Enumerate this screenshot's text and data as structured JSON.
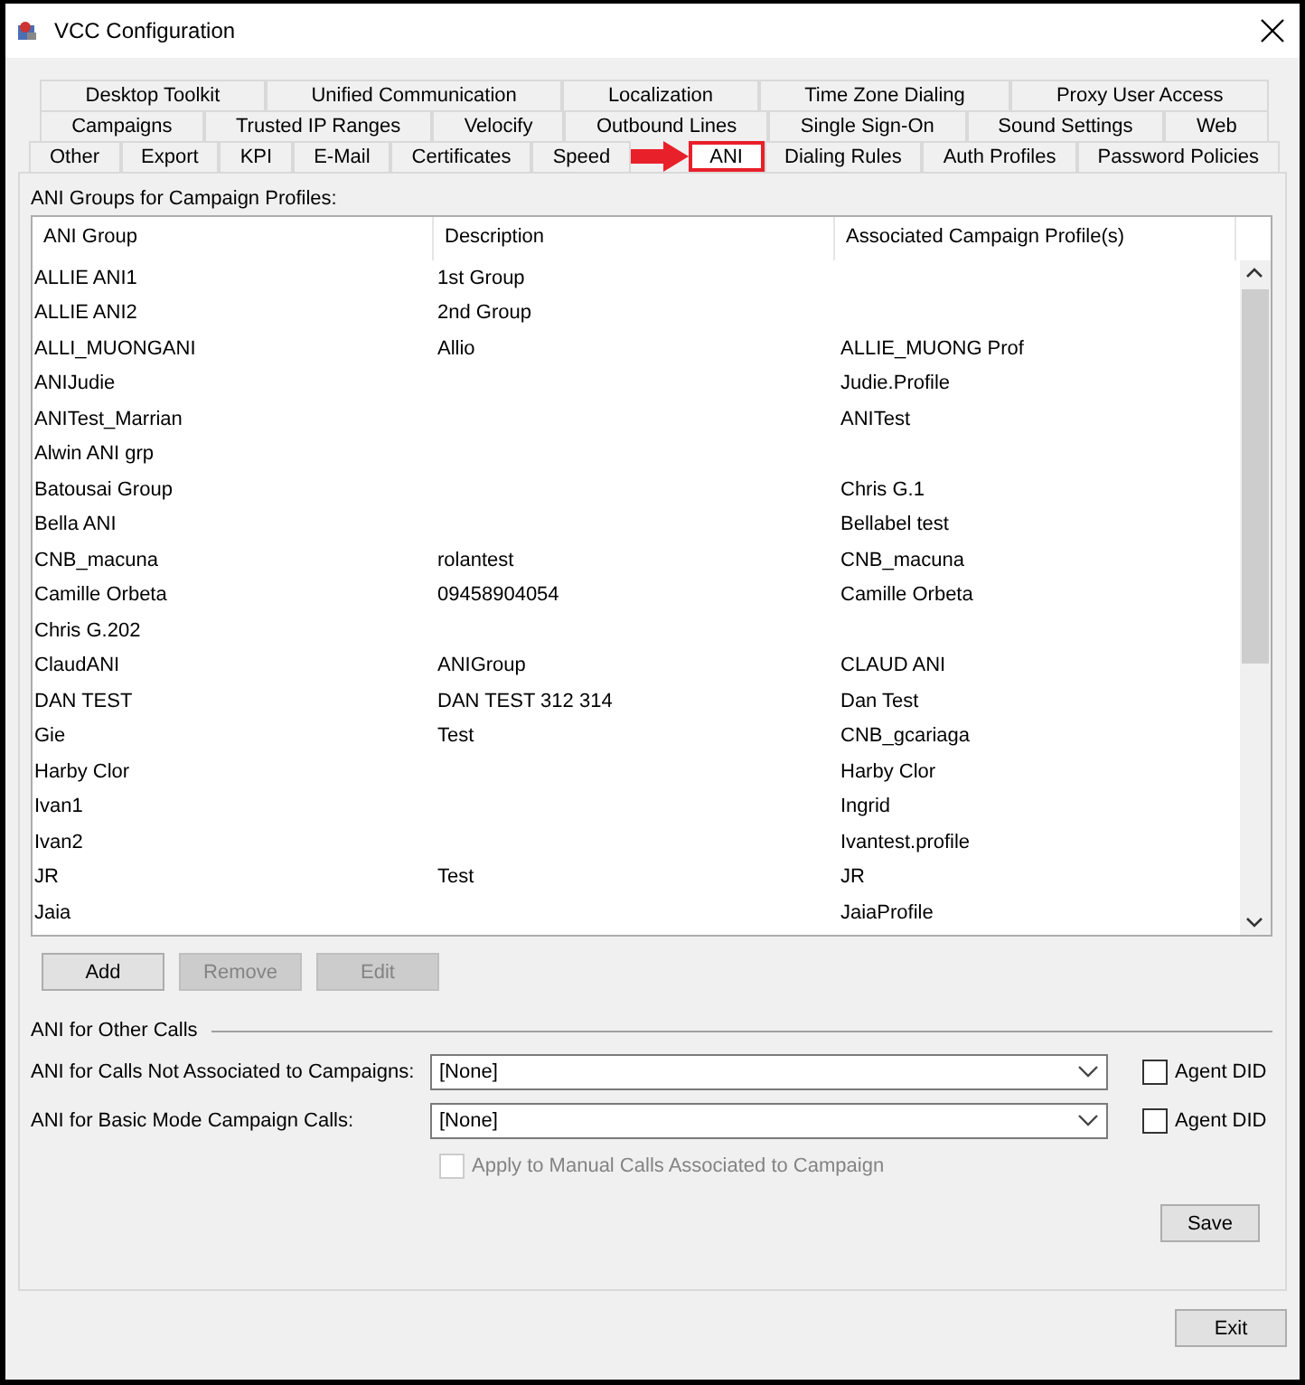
{
  "window": {
    "title": "VCC Configuration"
  },
  "tab_rows": [
    [
      {
        "label": "Desktop Toolkit",
        "selected": false
      },
      {
        "label": "Unified Communication",
        "selected": false
      },
      {
        "label": "Localization",
        "selected": false
      },
      {
        "label": "Time Zone Dialing",
        "selected": false
      },
      {
        "label": "Proxy User Access",
        "selected": false
      }
    ],
    [
      {
        "label": "Campaigns",
        "selected": false
      },
      {
        "label": "Trusted IP Ranges",
        "selected": false
      },
      {
        "label": "Velocify",
        "selected": false
      },
      {
        "label": "Outbound Lines",
        "selected": false
      },
      {
        "label": "Single Sign-On",
        "selected": false
      },
      {
        "label": "Sound Settings",
        "selected": false
      },
      {
        "label": "Web",
        "selected": false
      }
    ],
    [
      {
        "label": "Other",
        "selected": false
      },
      {
        "label": "Export",
        "selected": false
      },
      {
        "label": "KPI",
        "selected": false
      },
      {
        "label": "E-Mail",
        "selected": false
      },
      {
        "label": "Certificates",
        "selected": false
      },
      {
        "label": "Speed",
        "selected": false
      },
      {
        "label": "ANI",
        "selected": true
      },
      {
        "label": "Dialing Rules",
        "selected": false
      },
      {
        "label": "Auth Profiles",
        "selected": false
      },
      {
        "label": "Password Policies",
        "selected": false
      }
    ]
  ],
  "ani_groups": {
    "label": "ANI Groups for Campaign Profiles:",
    "columns": [
      "ANI Group",
      "Description",
      "Associated Campaign Profile(s)"
    ],
    "rows": [
      [
        "ALLIE ANI1",
        "1st Group",
        ""
      ],
      [
        "ALLIE ANI2",
        "2nd Group",
        ""
      ],
      [
        "ALLI_MUONGANI",
        "Allio",
        "ALLIE_MUONG Prof"
      ],
      [
        "ANIJudie",
        "",
        "Judie.Profile"
      ],
      [
        "ANITest_Marrian",
        "",
        "ANITest"
      ],
      [
        "Alwin ANI grp",
        "",
        ""
      ],
      [
        "Batousai Group",
        "",
        "Chris G.1"
      ],
      [
        "Bella ANI",
        "",
        "Bellabel test"
      ],
      [
        "CNB_macuna",
        "rolantest",
        "CNB_macuna"
      ],
      [
        "Camille Orbeta",
        "09458904054",
        "Camille Orbeta"
      ],
      [
        "Chris G.202",
        "",
        ""
      ],
      [
        "ClaudANI",
        "ANIGroup",
        "CLAUD ANI"
      ],
      [
        "DAN TEST",
        "DAN TEST 312 314",
        "Dan Test"
      ],
      [
        "Gie",
        "Test",
        "CNB_gcariaga"
      ],
      [
        "Harby Clor",
        "",
        "Harby Clor"
      ],
      [
        "Ivan1",
        "",
        "Ingrid"
      ],
      [
        "Ivan2",
        "",
        "Ivantest.profile"
      ],
      [
        "JR",
        "Test",
        "JR"
      ],
      [
        "Jaia",
        "",
        "JaiaProfile"
      ]
    ],
    "buttons": [
      {
        "label": "Add",
        "disabled": false
      },
      {
        "label": "Remove",
        "disabled": true
      },
      {
        "label": "Edit",
        "disabled": true
      }
    ]
  },
  "other_calls": {
    "title": "ANI for Other Calls",
    "rows": [
      {
        "label": "ANI for Calls Not Associated to Campaigns:",
        "value": "[None]",
        "checkbox": {
          "label": "Agent DID",
          "checked": false
        }
      },
      {
        "label": "ANI for Basic Mode Campaign Calls:",
        "value": "[None]",
        "checkbox": {
          "label": "Agent DID",
          "checked": false
        }
      }
    ],
    "apply_manual": {
      "label": "Apply to Manual Calls Associated to Campaign",
      "checked": false,
      "disabled": true
    }
  },
  "save_button": "Save",
  "exit_button": "Exit"
}
